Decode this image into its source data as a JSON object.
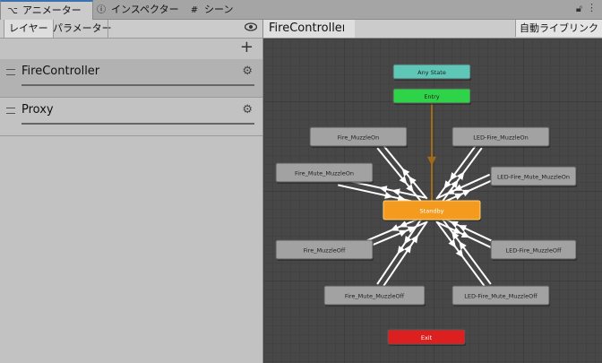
{
  "tabs": [
    {
      "icon": "animator-icon",
      "glyph": "⌥",
      "label": "アニメーター"
    },
    {
      "icon": "info-icon",
      "glyph": "ⓘ",
      "label": "インスペクター"
    },
    {
      "icon": "scene-grid-icon",
      "glyph": "#",
      "label": "シーン"
    }
  ],
  "left_panel": {
    "subtabs": [
      "レイヤー",
      "パラメーター"
    ],
    "layers": [
      "FireController",
      "Proxy"
    ]
  },
  "graph": {
    "breadcrumb": "FireController",
    "auto_live_link": "自動ライブリンク",
    "states": [
      {
        "id": "any",
        "label": "Any State",
        "kind": "any"
      },
      {
        "id": "entry",
        "label": "Entry",
        "kind": "entry"
      },
      {
        "id": "fire_on",
        "label": "Fire_MuzzleOn",
        "kind": "normal"
      },
      {
        "id": "led_on",
        "label": "LED-Fire_MuzzleOn",
        "kind": "normal"
      },
      {
        "id": "fire_mute_on",
        "label": "Fire_Mute_MuzzleOn",
        "kind": "normal"
      },
      {
        "id": "led_mute_on",
        "label": "LED-Fire_Mute_MuzzleOn",
        "kind": "normal"
      },
      {
        "id": "standby",
        "label": "Standby",
        "kind": "default"
      },
      {
        "id": "fire_off",
        "label": "Fire_MuzzleOff",
        "kind": "normal"
      },
      {
        "id": "led_off",
        "label": "LED-Fire_MuzzleOff",
        "kind": "normal"
      },
      {
        "id": "fire_mute_off",
        "label": "Fire_Mute_MuzzleOff",
        "kind": "normal"
      },
      {
        "id": "led_mute_off",
        "label": "LED-Fire_Mute_MuzzleOff",
        "kind": "normal"
      },
      {
        "id": "exit",
        "label": "Exit",
        "kind": "exit"
      }
    ],
    "colors": {
      "any": "#5fc7b8",
      "entry": "#2fd34a",
      "normal": "#a2a2a2",
      "default": "#f39a1f",
      "exit": "#dc1f1f",
      "transition": "#ffffff",
      "entry_transition": "#a26a17"
    }
  }
}
